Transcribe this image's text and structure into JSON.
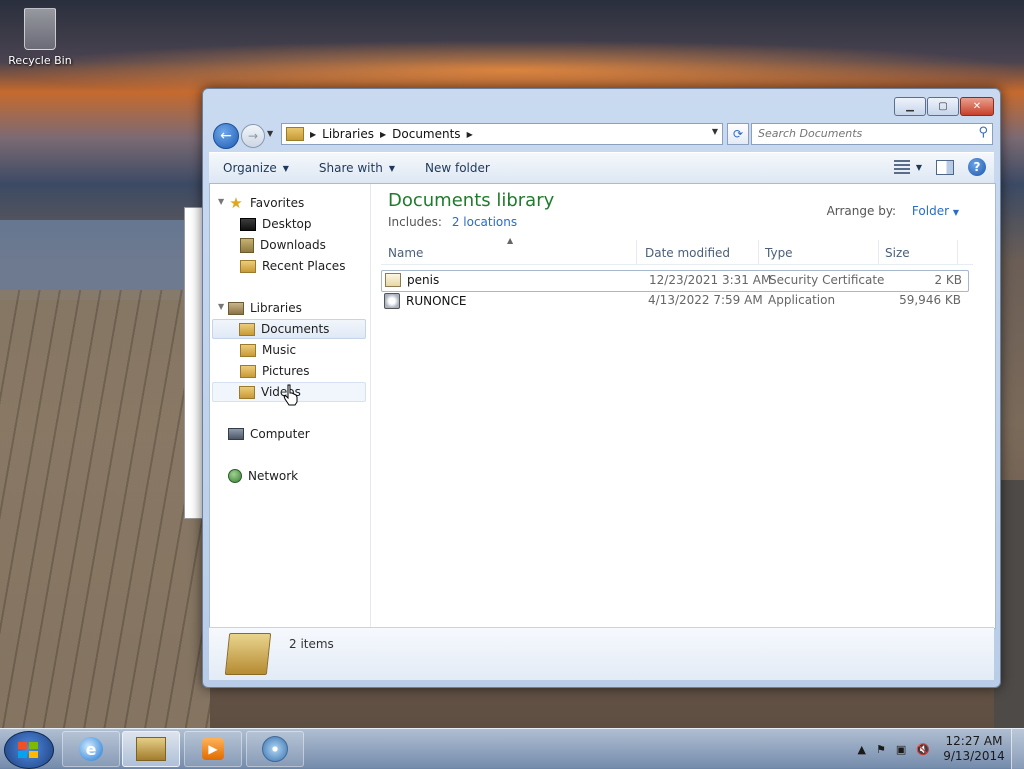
{
  "desktop": {
    "icons": [
      {
        "label": "Recycle Bin",
        "icon": "recycle-bin-icon"
      }
    ]
  },
  "window": {
    "address": {
      "crumbs": [
        "Libraries",
        "Documents"
      ]
    },
    "search": {
      "placeholder": "Search Documents"
    },
    "toolbar": {
      "organize": "Organize",
      "share_with": "Share with",
      "new_folder": "New folder"
    },
    "nav_pane": {
      "favorites": {
        "label": "Favorites",
        "items": [
          "Desktop",
          "Downloads",
          "Recent Places"
        ]
      },
      "libraries": {
        "label": "Libraries",
        "items": [
          "Documents",
          "Music",
          "Pictures",
          "Videos"
        ],
        "selected": "Documents"
      },
      "computer": "Computer",
      "network": "Network"
    },
    "library": {
      "title": "Documents library",
      "includes_label": "Includes:",
      "includes_link": "2 locations",
      "arrange_label": "Arrange by:",
      "arrange_value": "Folder"
    },
    "columns": [
      "Name",
      "Date modified",
      "Type",
      "Size"
    ],
    "files": [
      {
        "name": "penis",
        "date": "12/23/2021 3:31 AM",
        "type": "Security Certificate",
        "size": "2 KB",
        "icon": "certificate-icon"
      },
      {
        "name": "RUNONCE",
        "date": "4/13/2022 7:59 AM",
        "type": "Application",
        "size": "59,946 KB",
        "icon": "application-icon"
      }
    ],
    "details": {
      "count": "2 items"
    }
  },
  "taskbar": {
    "apps": [
      "internet-explorer-icon",
      "windows-explorer-icon",
      "media-player-icon",
      "disc-burner-icon"
    ],
    "clock": {
      "time": "12:27 AM",
      "date": "9/13/2014"
    }
  }
}
